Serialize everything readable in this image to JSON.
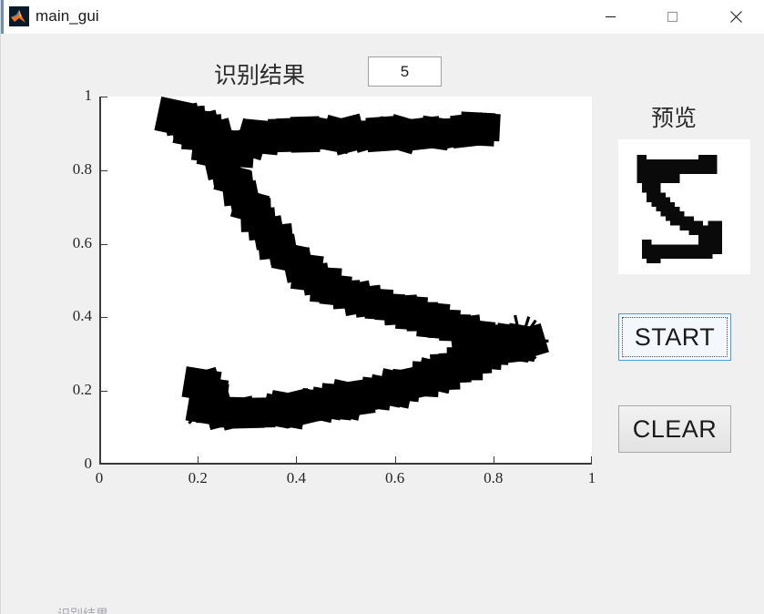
{
  "window": {
    "title": "main_gui",
    "app_icon": "matlab-icon",
    "background_color": "#f0f0f0",
    "titlebar_color": "#ffffff",
    "controls": {
      "minimize": "minimize-icon",
      "maximize": "maximize-icon",
      "close": "close-icon"
    }
  },
  "header": {
    "result_label": "识别结果",
    "result_value": "5"
  },
  "right_panel": {
    "preview_title": "预览",
    "preview_image_alt": "pixelated-digit-5",
    "start_label": "START",
    "clear_label": "CLEAR",
    "start_focused": true,
    "accent_color": "#4b9bdd"
  },
  "bottom_clipped_text": "识别结果",
  "chart_data": {
    "type": "scatter",
    "title": "",
    "xlabel": "",
    "ylabel": "",
    "xlim": [
      0,
      1
    ],
    "ylim": [
      0,
      1
    ],
    "grid": false,
    "legend": null,
    "xticks": [
      0,
      0.2,
      0.4,
      0.6,
      0.8,
      1
    ],
    "xtick_labels": [
      "0",
      "0.2",
      "0.4",
      "0.6",
      "0.8",
      "1"
    ],
    "yticks": [
      0,
      0.2,
      0.4,
      0.6,
      0.8,
      1
    ],
    "ytick_labels": [
      "0",
      "0.2",
      "0.4",
      "0.6",
      "0.8",
      "1"
    ],
    "series": [
      {
        "name": "ink-stroke-top-bar",
        "color": "#000000",
        "marker": "square",
        "marker_size": 0.062,
        "points": [
          [
            0.152,
            0.945
          ],
          [
            0.168,
            0.938
          ],
          [
            0.182,
            0.93
          ],
          [
            0.196,
            0.921
          ],
          [
            0.21,
            0.912
          ],
          [
            0.224,
            0.902
          ],
          [
            0.238,
            0.89
          ],
          [
            0.252,
            0.876
          ],
          [
            0.266,
            0.862
          ],
          [
            0.28,
            0.848
          ],
          [
            0.292,
            0.872
          ],
          [
            0.31,
            0.884
          ],
          [
            0.33,
            0.89
          ],
          [
            0.352,
            0.893
          ],
          [
            0.374,
            0.895
          ],
          [
            0.396,
            0.896
          ],
          [
            0.418,
            0.897
          ],
          [
            0.44,
            0.897
          ],
          [
            0.462,
            0.897
          ],
          [
            0.484,
            0.897
          ],
          [
            0.506,
            0.897
          ],
          [
            0.528,
            0.897
          ],
          [
            0.55,
            0.897
          ],
          [
            0.572,
            0.898
          ],
          [
            0.594,
            0.898
          ],
          [
            0.616,
            0.898
          ],
          [
            0.638,
            0.899
          ],
          [
            0.66,
            0.9
          ],
          [
            0.682,
            0.901
          ],
          [
            0.704,
            0.902
          ],
          [
            0.726,
            0.904
          ],
          [
            0.748,
            0.908
          ],
          [
            0.768,
            0.912
          ],
          [
            0.784,
            0.917
          ]
        ]
      },
      {
        "name": "ink-stroke-diagonal",
        "color": "#000000",
        "marker": "square",
        "marker_size": 0.062,
        "points": [
          [
            0.176,
            0.93
          ],
          [
            0.19,
            0.912
          ],
          [
            0.204,
            0.892
          ],
          [
            0.218,
            0.87
          ],
          [
            0.232,
            0.846
          ],
          [
            0.246,
            0.822
          ],
          [
            0.258,
            0.798
          ],
          [
            0.27,
            0.774
          ],
          [
            0.282,
            0.75
          ],
          [
            0.294,
            0.726
          ],
          [
            0.306,
            0.702
          ],
          [
            0.318,
            0.678
          ],
          [
            0.33,
            0.654
          ],
          [
            0.344,
            0.63
          ],
          [
            0.358,
            0.606
          ],
          [
            0.372,
            0.584
          ],
          [
            0.388,
            0.562
          ],
          [
            0.404,
            0.542
          ],
          [
            0.422,
            0.522
          ],
          [
            0.44,
            0.504
          ],
          [
            0.46,
            0.488
          ],
          [
            0.48,
            0.474
          ],
          [
            0.502,
            0.462
          ],
          [
            0.524,
            0.452
          ],
          [
            0.546,
            0.444
          ],
          [
            0.568,
            0.436
          ],
          [
            0.59,
            0.428
          ],
          [
            0.612,
            0.42
          ],
          [
            0.634,
            0.412
          ],
          [
            0.656,
            0.402
          ],
          [
            0.678,
            0.392
          ],
          [
            0.7,
            0.382
          ],
          [
            0.722,
            0.372
          ],
          [
            0.744,
            0.362
          ],
          [
            0.766,
            0.352
          ],
          [
            0.788,
            0.344
          ],
          [
            0.81,
            0.338
          ],
          [
            0.832,
            0.334
          ],
          [
            0.854,
            0.332
          ],
          [
            0.872,
            0.332
          ]
        ]
      },
      {
        "name": "ink-stroke-bottom-curve",
        "color": "#000000",
        "marker": "square",
        "marker_size": 0.062,
        "points": [
          [
            0.208,
            0.218
          ],
          [
            0.216,
            0.208
          ],
          [
            0.224,
            0.196
          ],
          [
            0.232,
            0.182
          ],
          [
            0.222,
            0.172
          ],
          [
            0.216,
            0.16
          ],
          [
            0.228,
            0.152
          ],
          [
            0.244,
            0.146
          ],
          [
            0.262,
            0.142
          ],
          [
            0.282,
            0.14
          ],
          [
            0.302,
            0.14
          ],
          [
            0.322,
            0.141
          ],
          [
            0.342,
            0.143
          ],
          [
            0.362,
            0.146
          ],
          [
            0.382,
            0.149
          ],
          [
            0.402,
            0.153
          ],
          [
            0.422,
            0.157
          ],
          [
            0.442,
            0.161
          ],
          [
            0.462,
            0.166
          ],
          [
            0.482,
            0.171
          ],
          [
            0.502,
            0.176
          ],
          [
            0.522,
            0.181
          ],
          [
            0.542,
            0.187
          ],
          [
            0.562,
            0.193
          ],
          [
            0.582,
            0.2
          ],
          [
            0.602,
            0.207
          ],
          [
            0.622,
            0.215
          ],
          [
            0.642,
            0.223
          ],
          [
            0.662,
            0.232
          ],
          [
            0.682,
            0.242
          ],
          [
            0.702,
            0.252
          ],
          [
            0.722,
            0.263
          ],
          [
            0.742,
            0.274
          ],
          [
            0.762,
            0.286
          ],
          [
            0.782,
            0.298
          ],
          [
            0.802,
            0.31
          ],
          [
            0.822,
            0.32
          ],
          [
            0.842,
            0.328
          ],
          [
            0.858,
            0.332
          ]
        ]
      },
      {
        "name": "ink-junction-spikes",
        "color": "#000000",
        "marker": "line",
        "points": [
          [
            0.856,
            0.334
          ],
          [
            0.912,
            0.336
          ],
          [
            0.856,
            0.334
          ],
          [
            0.902,
            0.308
          ],
          [
            0.856,
            0.334
          ],
          [
            0.886,
            0.288
          ],
          [
            0.856,
            0.334
          ],
          [
            0.87,
            0.28
          ],
          [
            0.856,
            0.334
          ],
          [
            0.886,
            0.392
          ],
          [
            0.856,
            0.334
          ],
          [
            0.872,
            0.402
          ],
          [
            0.856,
            0.334
          ],
          [
            0.844,
            0.406
          ],
          [
            0.152,
            0.948
          ],
          [
            0.21,
            0.948
          ],
          [
            0.213,
            0.16
          ],
          [
            0.182,
            0.112
          ]
        ]
      }
    ]
  }
}
